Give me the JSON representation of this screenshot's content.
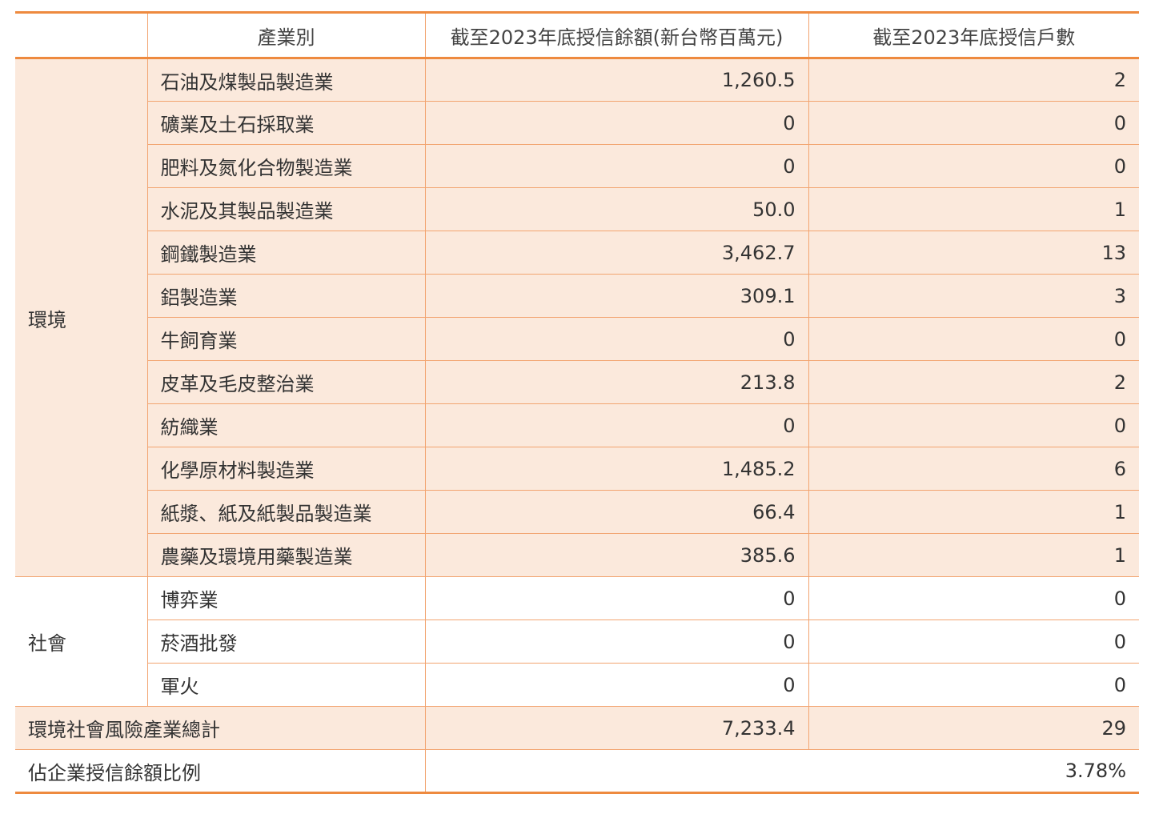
{
  "header": {
    "blank": "",
    "industry": "產業別",
    "amount": "截至2023年底授信餘額(新台幣百萬元)",
    "count": "截至2023年底授信戶數"
  },
  "groups": [
    {
      "name": "環境",
      "rows": [
        {
          "industry": "石油及煤製品製造業",
          "amount": "1,260.5",
          "count": "2"
        },
        {
          "industry": "礦業及土石採取業",
          "amount": "0",
          "count": "0"
        },
        {
          "industry": "肥料及氮化合物製造業",
          "amount": "0",
          "count": "0"
        },
        {
          "industry": "水泥及其製品製造業",
          "amount": "50.0",
          "count": "1"
        },
        {
          "industry": "鋼鐵製造業",
          "amount": "3,462.7",
          "count": "13"
        },
        {
          "industry": "鋁製造業",
          "amount": "309.1",
          "count": "3"
        },
        {
          "industry": "牛飼育業",
          "amount": "0",
          "count": "0"
        },
        {
          "industry": "皮革及毛皮整治業",
          "amount": "213.8",
          "count": "2"
        },
        {
          "industry": "紡織業",
          "amount": "0",
          "count": "0"
        },
        {
          "industry": "化學原材料製造業",
          "amount": "1,485.2",
          "count": "6"
        },
        {
          "industry": "紙漿、紙及紙製品製造業",
          "amount": "66.4",
          "count": "1"
        },
        {
          "industry": "農藥及環境用藥製造業",
          "amount": "385.6",
          "count": "1"
        }
      ]
    },
    {
      "name": "社會",
      "rows": [
        {
          "industry": "博弈業",
          "amount": "0",
          "count": "0"
        },
        {
          "industry": "菸酒批發",
          "amount": "0",
          "count": "0"
        },
        {
          "industry": "軍火",
          "amount": "0",
          "count": "0"
        }
      ]
    }
  ],
  "total": {
    "label": "環境社會風險產業總計",
    "amount": "7,233.4",
    "count": "29"
  },
  "ratio": {
    "label": "佔企業授信餘額比例",
    "value": "3.78%"
  },
  "colors": {
    "accent": "#ee8a3f",
    "border": "#f2a470",
    "shade": "#fbe9dc"
  }
}
